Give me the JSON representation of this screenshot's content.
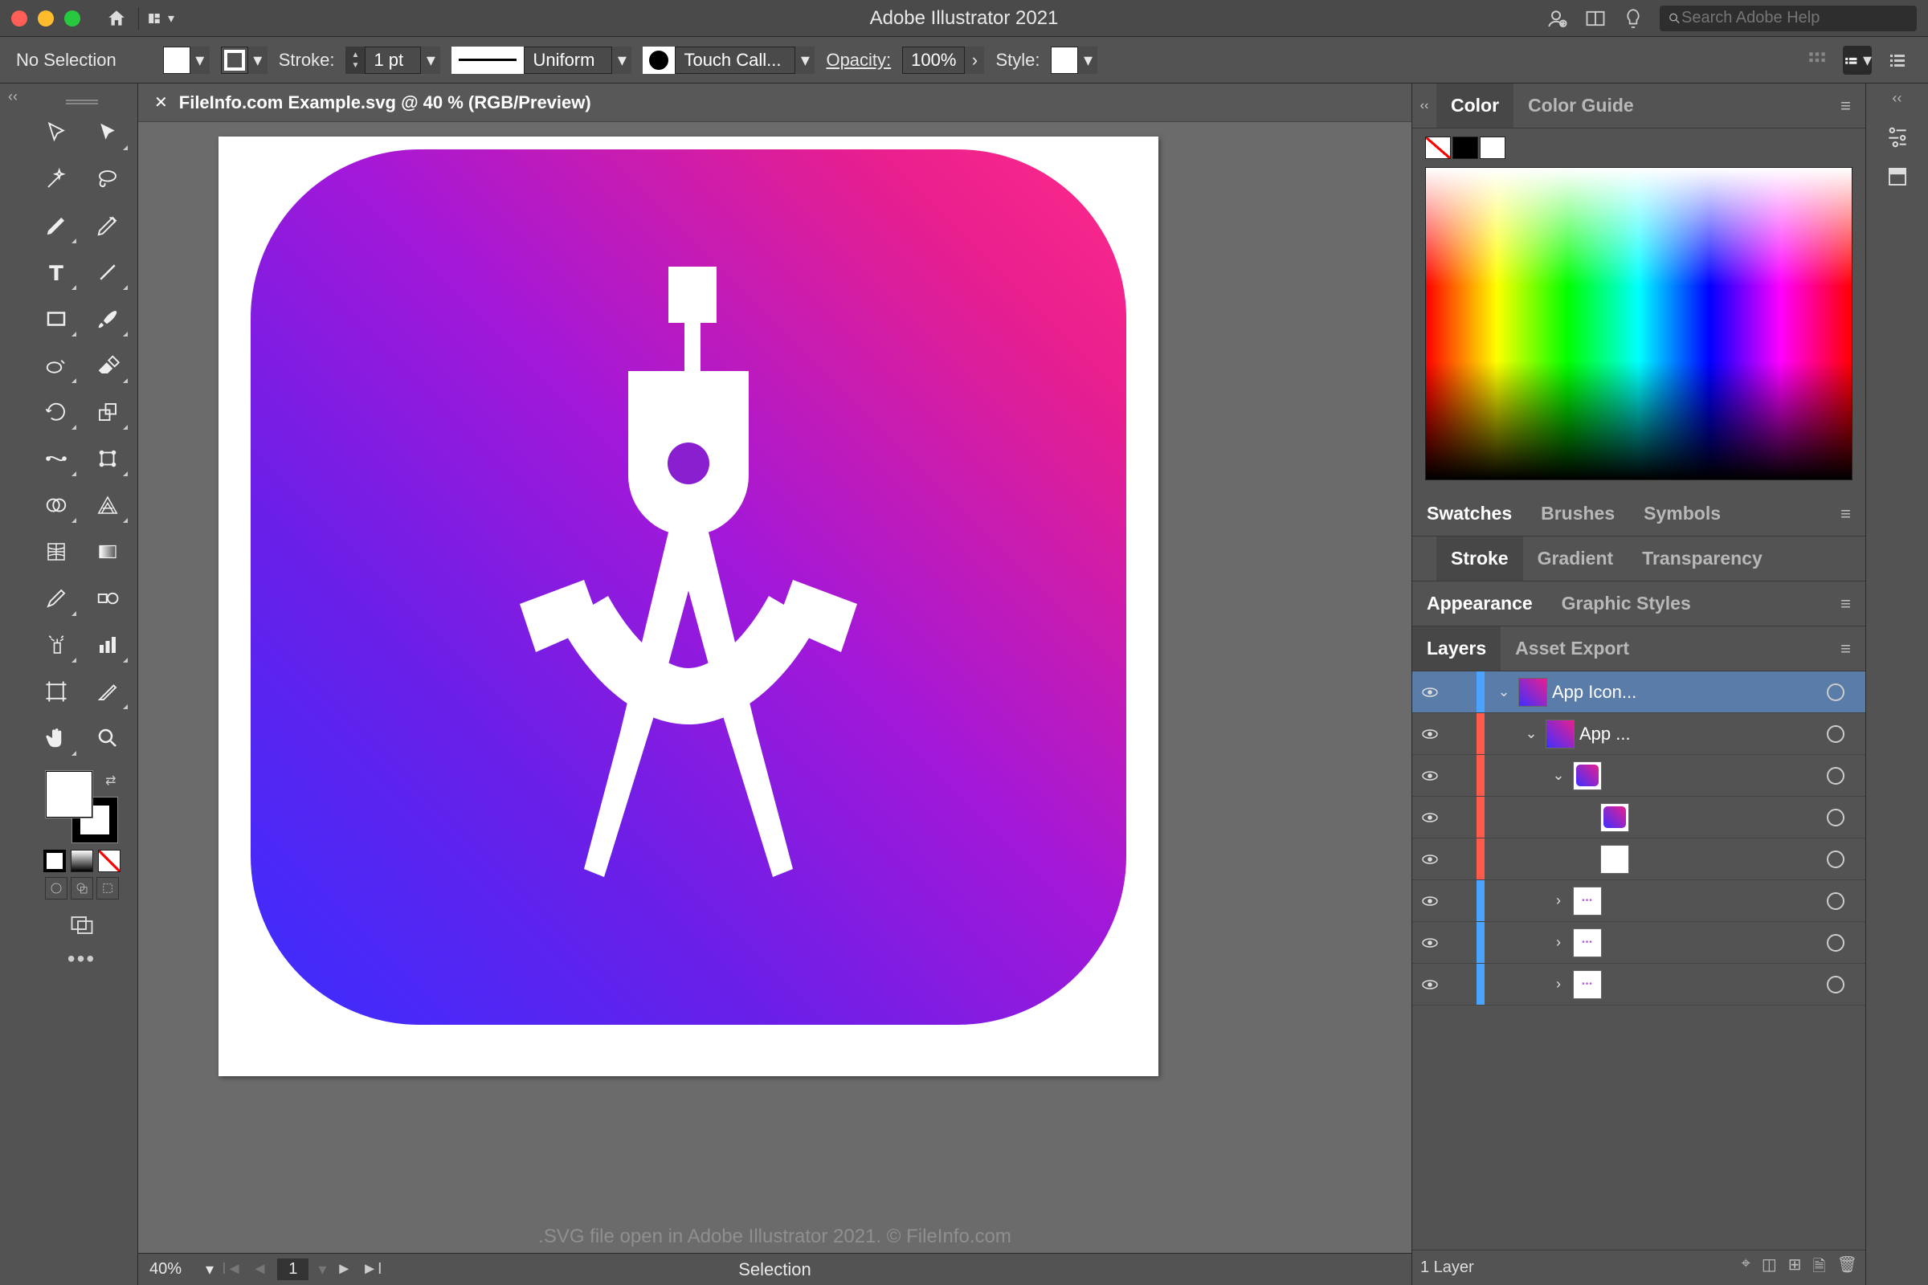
{
  "titlebar": {
    "app_title": "Adobe Illustrator 2021",
    "search_placeholder": "Search Adobe Help"
  },
  "controlbar": {
    "selection_state": "No Selection",
    "stroke_label": "Stroke:",
    "stroke_value": "1 pt",
    "stroke_profile": "Uniform",
    "brush_label": "Touch Call...",
    "opacity_label": "Opacity:",
    "opacity_value": "100%",
    "style_label": "Style:"
  },
  "document": {
    "tab_label": "FileInfo.com Example.svg @ 40 % (RGB/Preview)",
    "caption": ".SVG file open in Adobe Illustrator 2021. © FileInfo.com"
  },
  "status": {
    "zoom": "40%",
    "artboard_index": "1",
    "tool_name": "Selection"
  },
  "panels": {
    "color_tab": "Color",
    "color_guide_tab": "Color Guide",
    "swatches_tab": "Swatches",
    "brushes_tab": "Brushes",
    "symbols_tab": "Symbols",
    "stroke_tab": "Stroke",
    "gradient_tab": "Gradient",
    "transparency_tab": "Transparency",
    "appearance_tab": "Appearance",
    "graphic_styles_tab": "Graphic Styles",
    "layers_tab": "Layers",
    "asset_export_tab": "Asset Export"
  },
  "layers": {
    "footer_label": "1 Layer",
    "items": [
      {
        "name": "App Icon...",
        "edge": "#4aa3ff",
        "indent": 0,
        "disclosure": "open",
        "selected": true,
        "thumb": "grad"
      },
      {
        "name": "App ...",
        "edge": "#ff5a4a",
        "indent": 1,
        "disclosure": "open",
        "selected": false,
        "thumb": "grad"
      },
      {
        "name": "",
        "edge": "#ff5a4a",
        "indent": 2,
        "disclosure": "open",
        "selected": false,
        "thumb": "grad-sm"
      },
      {
        "name": "",
        "edge": "#ff5a4a",
        "indent": 3,
        "disclosure": "none",
        "selected": false,
        "thumb": "grad-sm"
      },
      {
        "name": "",
        "edge": "#ff5a4a",
        "indent": 3,
        "disclosure": "none",
        "selected": false,
        "thumb": "white"
      },
      {
        "name": "",
        "edge": "#4aa3ff",
        "indent": 2,
        "disclosure": "closed",
        "selected": false,
        "thumb": "dots"
      },
      {
        "name": "",
        "edge": "#4aa3ff",
        "indent": 2,
        "disclosure": "closed",
        "selected": false,
        "thumb": "dots"
      },
      {
        "name": "",
        "edge": "#4aa3ff",
        "indent": 2,
        "disclosure": "closed",
        "selected": false,
        "thumb": "dots"
      }
    ]
  }
}
